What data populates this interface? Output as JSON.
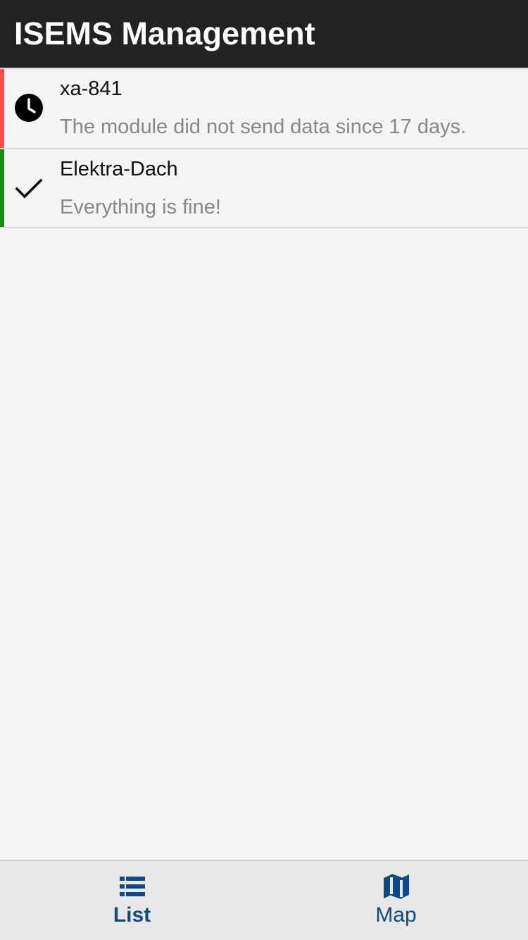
{
  "header": {
    "title": "ISEMS Management"
  },
  "modules": [
    {
      "name": "xa-841",
      "message": "The module did not send data since 17 days.",
      "status_icon": "clock-icon",
      "status_color": "#ff4d4d"
    },
    {
      "name": "Elektra-Dach",
      "message": "Everything is fine!",
      "status_icon": "checkmark-icon",
      "status_color": "#1a8a1a"
    }
  ],
  "tabs": [
    {
      "label": "List",
      "icon": "list-icon",
      "active": true
    },
    {
      "label": "Map",
      "icon": "map-icon",
      "active": false
    }
  ],
  "colors": {
    "header_bg": "#222222",
    "accent": "#0f4a86",
    "background": "#f4f4f4"
  }
}
